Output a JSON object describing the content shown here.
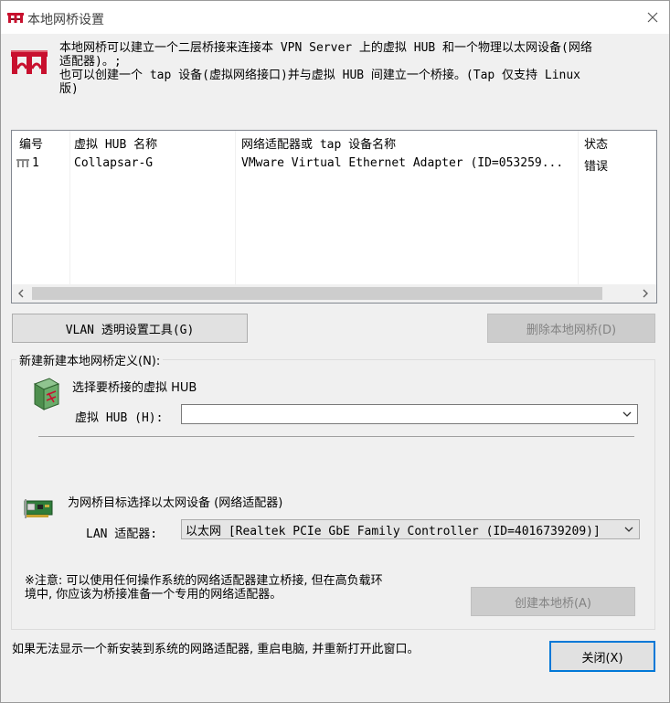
{
  "window": {
    "title": "本地网桥设置"
  },
  "description": {
    "line1": "本地网桥可以建立一个二层桥接来连接本 VPN Server 上的虚拟 HUB 和一个物理以太网设备(网络",
    "line2": "适配器)。;",
    "line3": "也可以创建一个 tap 设备(虚拟网络接口)并与虚拟 HUB 间建立一个桥接。(Tap 仅支持 Linux",
    "line4": "版)"
  },
  "table": {
    "columns": [
      "编号",
      "虚拟 HUB 名称",
      "网络适配器或 tap 设备名称",
      "状态"
    ],
    "rows": [
      {
        "id": "1",
        "hub": "Collapsar-G",
        "adapter": "VMware Virtual Ethernet Adapter (ID=053259...",
        "status": "错误"
      }
    ]
  },
  "buttons": {
    "vlan": "VLAN 透明设置工具(G)",
    "delete": "删除本地网桥(D)",
    "create": "创建本地桥(A)",
    "close": "关闭(X)"
  },
  "group": {
    "legend": "新建新建本地网桥定义(N):",
    "hub_section_title": "选择要桥接的虚拟 HUB",
    "hub_label": "虚拟 HUB (H):",
    "hub_value": "",
    "nic_section_title": "为网桥目标选择以太网设备 (网络适配器)",
    "lan_label": "LAN 适配器:",
    "lan_value": "以太网 [Realtek PCIe GbE Family Controller (ID=4016739209)]",
    "note_line1": "※注意: 可以使用任何操作系统的网络适配器建立桥接, 但在高负载环",
    "note_line2": "境中, 你应该为桥接准备一个专用的网络适配器。"
  },
  "footer": {
    "hint": "如果无法显示一个新安装到系统的网路适配器, 重启电脑, 并重新打开此窗口。"
  },
  "colors": {
    "accent": "#0078d7",
    "icon_red": "#c8102e"
  },
  "icons": {
    "title": "bridge-icon",
    "hub": "hub-icon",
    "nic": "nic-icon",
    "row": "bridge-row-icon"
  }
}
